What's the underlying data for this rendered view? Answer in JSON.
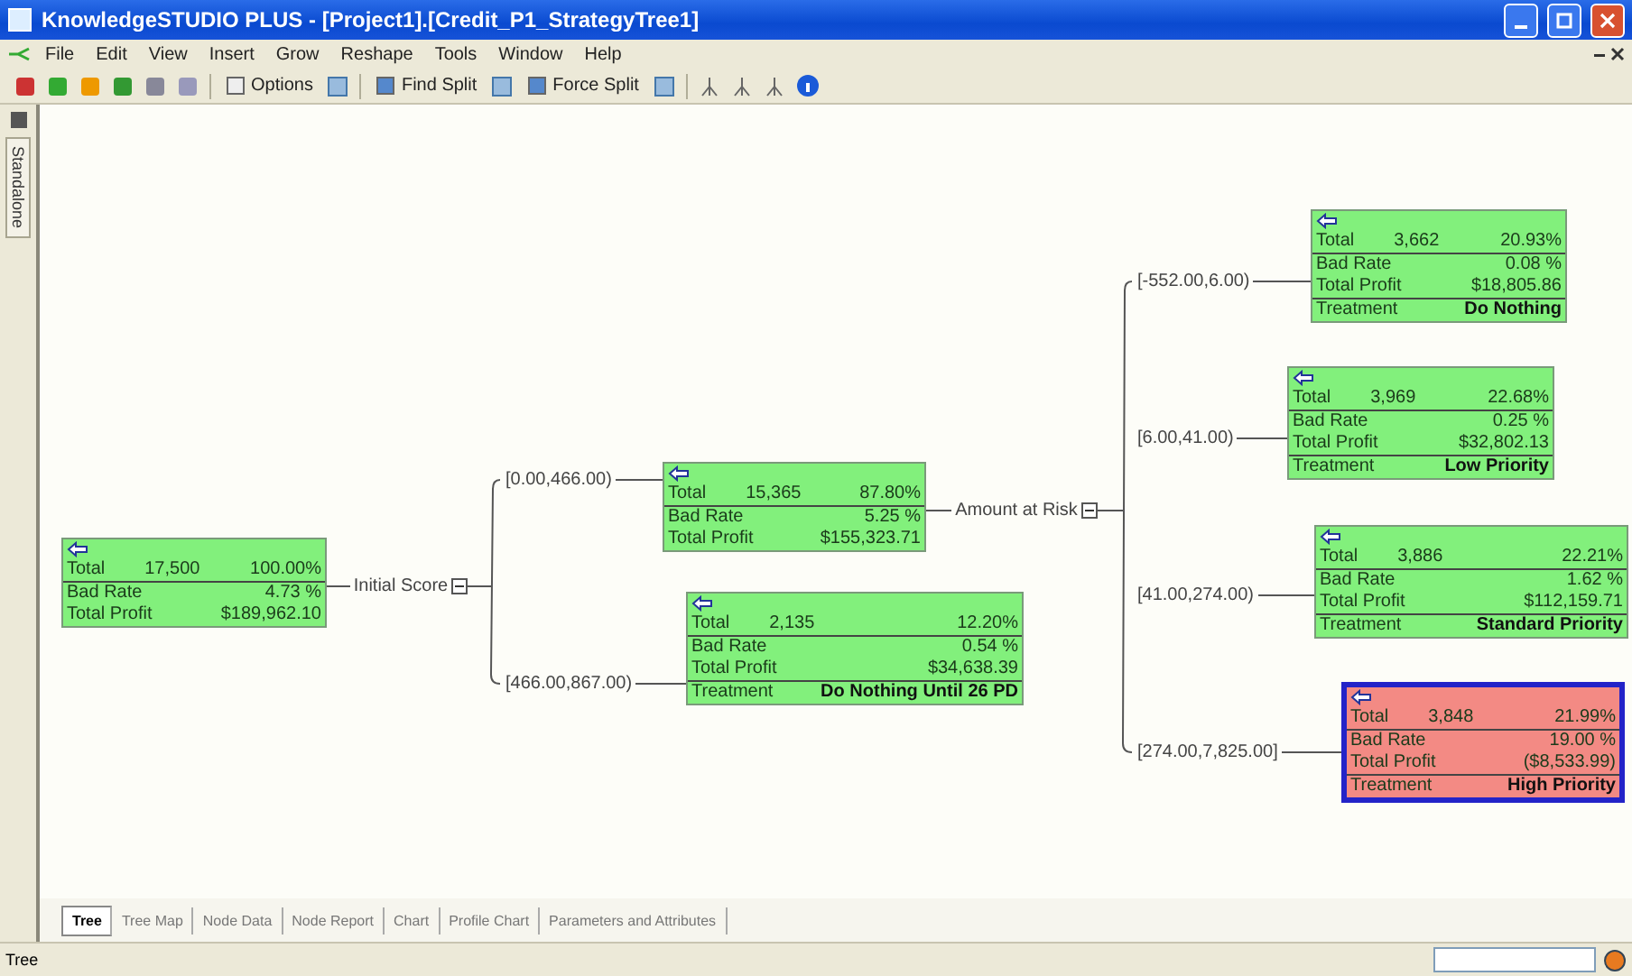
{
  "window": {
    "title": "KnowledgeSTUDIO PLUS - [Project1].[Credit_P1_StrategyTree1]"
  },
  "menu": [
    "File",
    "Edit",
    "View",
    "Insert",
    "Grow",
    "Reshape",
    "Tools",
    "Window",
    "Help"
  ],
  "toolbar": {
    "buttons": [
      "Options",
      "Find Split",
      "Force Split"
    ]
  },
  "side_tab": {
    "label": "Standalone"
  },
  "tree": {
    "node": {
      "kind": "green",
      "selected": false,
      "rows": [
        {
          "label": "Total",
          "values": [
            "17,500",
            "100.00%"
          ]
        },
        {
          "label": "Bad Rate",
          "values": [
            "4.73 %"
          ]
        },
        {
          "label": "Total Profit",
          "values": [
            "$189,962.10"
          ]
        }
      ]
    },
    "split": {
      "variable": "Initial Score",
      "expanded": true,
      "branches": [
        {
          "label": "[0.00,466.00)",
          "node": {
            "kind": "green",
            "selected": false,
            "rows": [
              {
                "label": "Total",
                "values": [
                  "15,365",
                  "87.80%"
                ]
              },
              {
                "label": "Bad Rate",
                "values": [
                  "5.25 %"
                ]
              },
              {
                "label": "Total Profit",
                "values": [
                  "$155,323.71"
                ]
              }
            ]
          },
          "split": {
            "variable": "Amount at Risk",
            "expanded": true,
            "branches": [
              {
                "label": "[-552.00,6.00)",
                "node": {
                  "kind": "green",
                  "selected": false,
                  "rows": [
                    {
                      "label": "Total",
                      "values": [
                        "3,662",
                        "20.93%"
                      ]
                    },
                    {
                      "label": "Bad Rate",
                      "values": [
                        "0.08 %"
                      ]
                    },
                    {
                      "label": "Total Profit",
                      "values": [
                        "$18,805.86"
                      ]
                    }
                  ],
                  "treatment": {
                    "label": "Treatment",
                    "value": "Do Nothing"
                  }
                }
              },
              {
                "label": "[6.00,41.00)",
                "node": {
                  "kind": "green",
                  "selected": false,
                  "rows": [
                    {
                      "label": "Total",
                      "values": [
                        "3,969",
                        "22.68%"
                      ]
                    },
                    {
                      "label": "Bad Rate",
                      "values": [
                        "0.25 %"
                      ]
                    },
                    {
                      "label": "Total Profit",
                      "values": [
                        "$32,802.13"
                      ]
                    }
                  ],
                  "treatment": {
                    "label": "Treatment",
                    "value": "Low Priority"
                  }
                }
              },
              {
                "label": "[41.00,274.00)",
                "node": {
                  "kind": "green",
                  "selected": false,
                  "rows": [
                    {
                      "label": "Total",
                      "values": [
                        "3,886",
                        "22.21%"
                      ]
                    },
                    {
                      "label": "Bad Rate",
                      "values": [
                        "1.62 %"
                      ]
                    },
                    {
                      "label": "Total Profit",
                      "values": [
                        "$112,159.71"
                      ]
                    }
                  ],
                  "treatment": {
                    "label": "Treatment",
                    "value": "Standard Priority"
                  }
                }
              },
              {
                "label": "[274.00,7,825.00]",
                "node": {
                  "kind": "red",
                  "selected": true,
                  "rows": [
                    {
                      "label": "Total",
                      "values": [
                        "3,848",
                        "21.99%"
                      ]
                    },
                    {
                      "label": "Bad Rate",
                      "values": [
                        "19.00 %"
                      ]
                    },
                    {
                      "label": "Total Profit",
                      "values": [
                        "($8,533.99)"
                      ]
                    }
                  ],
                  "treatment": {
                    "label": "Treatment",
                    "value": "High Priority"
                  }
                }
              }
            ]
          }
        },
        {
          "label": "[466.00,867.00)",
          "node": {
            "kind": "green",
            "selected": false,
            "rows": [
              {
                "label": "Total",
                "values": [
                  "2,135",
                  "12.20%"
                ]
              },
              {
                "label": "Bad Rate",
                "values": [
                  "0.54 %"
                ]
              },
              {
                "label": "Total Profit",
                "values": [
                  "$34,638.39"
                ]
              }
            ],
            "treatment": {
              "label": "Treatment",
              "value": "Do Nothing Until 26 PD"
            }
          }
        }
      ]
    }
  },
  "tabs": [
    {
      "label": "Tree",
      "selected": true
    },
    {
      "label": "Tree Map",
      "selected": false
    },
    {
      "label": "Node Data",
      "selected": false
    },
    {
      "label": "Node Report",
      "selected": false
    },
    {
      "label": "Chart",
      "selected": false
    },
    {
      "label": "Profile Chart",
      "selected": false
    },
    {
      "label": "Parameters and Attributes",
      "selected": false
    }
  ],
  "status_bar": {
    "text": "Tree"
  }
}
